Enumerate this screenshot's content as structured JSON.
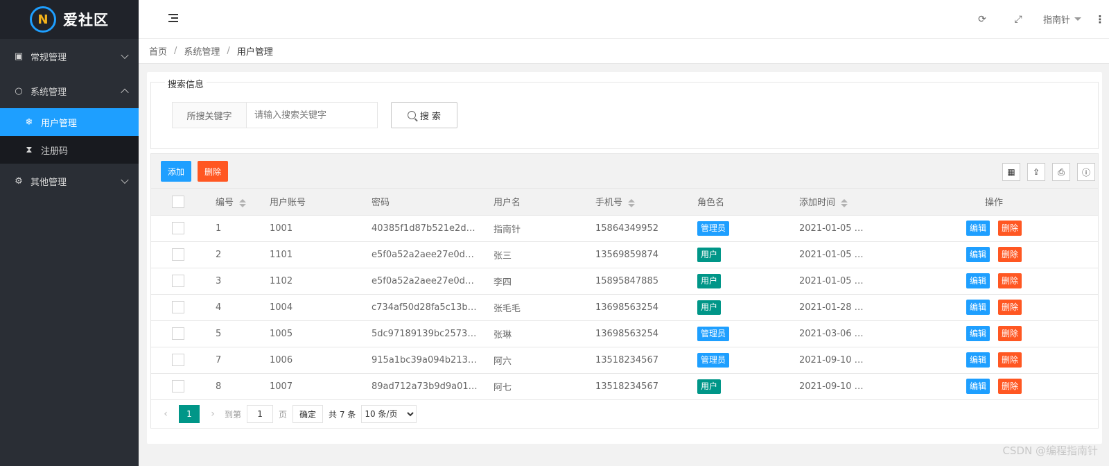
{
  "brand": {
    "name": "爱社区",
    "logo_letter": "N"
  },
  "sidebar": {
    "groups": [
      {
        "label": "常规管理",
        "icon": "contact-card-icon"
      },
      {
        "label": "系统管理",
        "icon": "chat-bubble-icon",
        "items": [
          {
            "label": "用户管理",
            "icon": "snowflake-icon",
            "active": true
          },
          {
            "label": "注册码",
            "icon": "hourglass-icon"
          }
        ]
      },
      {
        "label": "其他管理",
        "icon": "gear-icon"
      }
    ]
  },
  "header": {
    "user_name": "指南针"
  },
  "breadcrumb": [
    "首页",
    "系统管理",
    "用户管理"
  ],
  "search": {
    "legend": "搜索信息",
    "label": "所搜关键字",
    "placeholder": "请输入搜索关键字",
    "button": "搜 索"
  },
  "toolbar": {
    "add_label": "添加",
    "delete_label": "删除"
  },
  "table": {
    "columns": [
      "编号",
      "用户账号",
      "密码",
      "用户名",
      "手机号",
      "角色名",
      "添加时间",
      "操作"
    ],
    "rows": [
      {
        "id": "1",
        "account": "1001",
        "password": "40385f1d87b521e2d…",
        "name": "指南针",
        "phone": "15864349952",
        "role": "管理员",
        "created": "2021-01-05 …"
      },
      {
        "id": "2",
        "account": "1101",
        "password": "e5f0a52a2aee27e0d…",
        "name": "张三",
        "phone": "13569859874",
        "role": "用户",
        "created": "2021-01-05 …"
      },
      {
        "id": "3",
        "account": "1102",
        "password": "e5f0a52a2aee27e0d…",
        "name": "李四",
        "phone": "15895847885",
        "role": "用户",
        "created": "2021-01-05 …"
      },
      {
        "id": "4",
        "account": "1004",
        "password": "c734af50d28fa5c13b…",
        "name": "张毛毛",
        "phone": "13698563254",
        "role": "用户",
        "created": "2021-01-28 …"
      },
      {
        "id": "5",
        "account": "1005",
        "password": "5dc97189139bc2573…",
        "name": "张琳",
        "phone": "13698563254",
        "role": "管理员",
        "created": "2021-03-06 …"
      },
      {
        "id": "7",
        "account": "1006",
        "password": "915a1bc39a094b213…",
        "name": "阿六",
        "phone": "13518234567",
        "role": "管理员",
        "created": "2021-09-10 …"
      },
      {
        "id": "8",
        "account": "1007",
        "password": "89ad712a73b9d9a01…",
        "name": "阿七",
        "phone": "13518234567",
        "role": "用户",
        "created": "2021-09-10 …"
      }
    ],
    "edit_label": "编辑",
    "delete_label": "删除"
  },
  "pagination": {
    "current_page": "1",
    "goto_label": "到第",
    "page_input": "1",
    "page_unit": "页",
    "confirm": "确定",
    "total": "共 7 条",
    "page_size": "10 条/页"
  },
  "watermark": "CSDN @编程指南针",
  "colors": {
    "primary": "#1e9fff",
    "danger": "#ff5722",
    "teal": "#009688",
    "sidebar": "#2a2e35"
  }
}
